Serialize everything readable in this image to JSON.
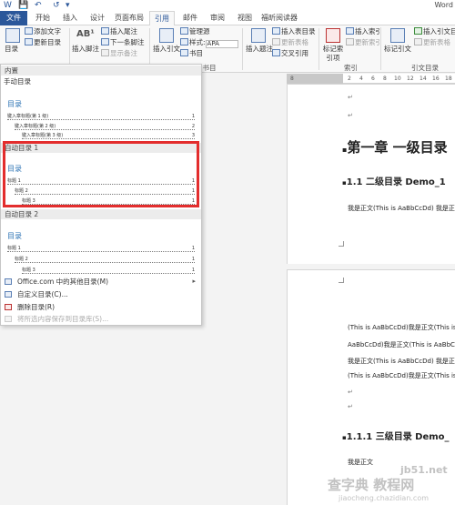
{
  "window": {
    "title": "Word",
    "quick_access": [
      "W",
      "💾",
      "↶",
      "↺",
      "▾"
    ]
  },
  "menu_tabs": [
    "文件",
    "开始",
    "插入",
    "设计",
    "页面布局",
    "引用",
    "邮件",
    "审阅",
    "视图",
    "福昕阅读器"
  ],
  "active_tab": "引用",
  "ribbon": {
    "toc": {
      "label": "目录",
      "add_text": "添加文字",
      "update_table": "更新目录"
    },
    "footnotes": {
      "big": "插入脚注",
      "insert_endnote": "插入尾注",
      "next_footnote": "下一条脚注",
      "show_notes": "显示备注"
    },
    "citations": {
      "big": "插入引文",
      "manage_sources": "管理源",
      "style_label": "样式:",
      "style_value": "APA",
      "bibliography": "书目",
      "group": "引文与书目"
    },
    "captions": {
      "big": "插入题注",
      "insert_table_of_figures": "插入表目录",
      "update_table": "更新表格",
      "cross_reference": "交叉引用"
    },
    "index": {
      "big": "标记索引项",
      "insert_index": "插入索引",
      "update_index": "更新索引",
      "group": "索引"
    },
    "authorities": {
      "big": "标记引文",
      "insert_table": "插入引文目",
      "update_table": "更新表格",
      "group": "引文目录"
    }
  },
  "dropdown": {
    "section_builtin": "内置",
    "manual_toc": {
      "header": "手动目录",
      "title": "目录",
      "lines": [
        "键入章标题(第 1 级)",
        "键入章标题(第 2 级)",
        "键入章标题(第 3 级)"
      ],
      "pages": [
        "1",
        "2",
        "3"
      ]
    },
    "auto_toc_1": {
      "header": "自动目录 1",
      "title": "目录",
      "lines": [
        "标题 1",
        "标题 2",
        "标题 3"
      ],
      "pages": [
        "1",
        "1",
        "1"
      ]
    },
    "auto_toc_2": {
      "header": "自动目录 2",
      "title": "目录",
      "lines": [
        "标题 1",
        "标题 2",
        "标题 3"
      ],
      "pages": [
        "1",
        "1",
        "1"
      ]
    },
    "menu_items": [
      {
        "label": "Office.com 中的其他目录(M)",
        "has_arrow": true,
        "disabled": false
      },
      {
        "label": "自定义目录(C)...",
        "has_arrow": false,
        "disabled": false
      },
      {
        "label": "删除目录(R)",
        "has_arrow": false,
        "disabled": false
      },
      {
        "label": "将所选内容保存到目录库(S)...",
        "has_arrow": false,
        "disabled": true
      }
    ]
  },
  "ruler": [
    "8",
    "2",
    "4",
    "6",
    "8",
    "10",
    "12",
    "14",
    "16",
    "18",
    "20"
  ],
  "document": {
    "para_mark": "↵",
    "heading1": "第一章  一级目录",
    "heading2": "1.1  二级目录 Demo_1",
    "body1": "我是正文(This is AaBbCcDd) 我是正",
    "page2_lines": [
      "(This is AaBbCcDd)我是正文(This is",
      "AaBbCcDd)我是正文(This is AaBbCc",
      "我是正文(This is AaBbCcDd) 我是正",
      "(This is AaBbCcDd)我是正文(This is"
    ],
    "heading3": "1.1.1  三级目录 Demo_",
    "body2": "我是正文"
  },
  "watermark": {
    "line1": "查字典 教程网",
    "site": "jb51.net",
    "line2": "jiaocheng.chazidian.com"
  }
}
